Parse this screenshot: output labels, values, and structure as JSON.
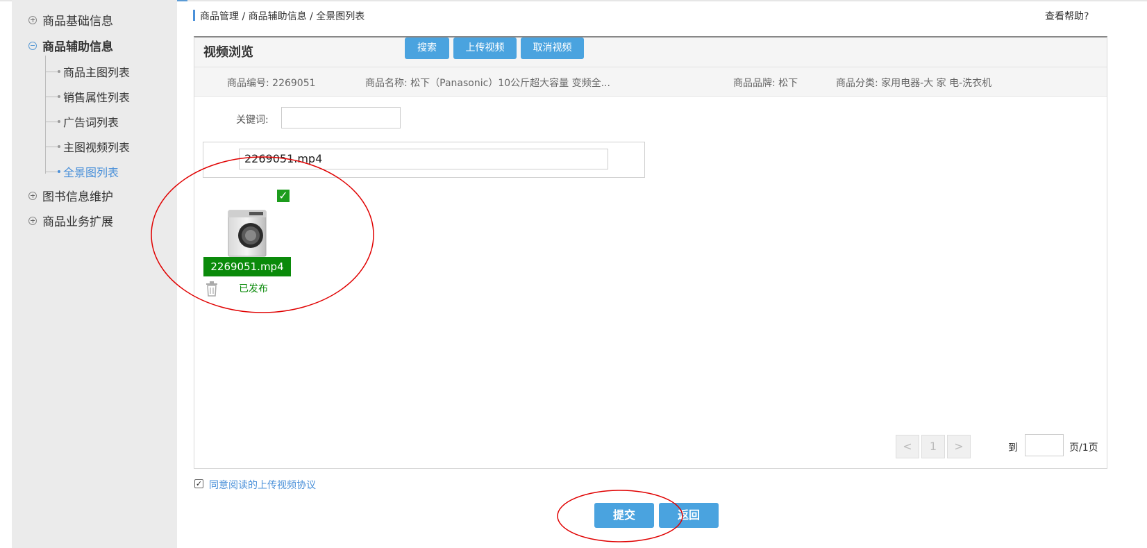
{
  "sidebar": {
    "groups": [
      {
        "label": "商品基础信息"
      },
      {
        "label": "商品辅助信息"
      },
      {
        "label": "图书信息维护"
      },
      {
        "label": "商品业务扩展"
      }
    ],
    "items": [
      {
        "label": "商品主图列表"
      },
      {
        "label": "销售属性列表"
      },
      {
        "label": "广告词列表"
      },
      {
        "label": "主图视频列表"
      },
      {
        "label": "全景图列表"
      }
    ]
  },
  "breadcrumb": "商品管理 / 商品辅助信息 / 全景图列表",
  "help_link": "查看帮助?",
  "panel": {
    "title": "视频浏览",
    "info": {
      "code": "商品编号:  2269051",
      "name": "商品名称:  松下（Panasonic）10公斤超大容量 变频全...",
      "brand": "商品品牌:  松下",
      "category": "商品分类:  家用电器-大 家 电-洗衣机"
    },
    "search": {
      "keyword_label": "关键词:",
      "keyword_value": "",
      "search_btn": "搜索",
      "upload_btn": "上传视频",
      "cancel_btn": "取消视频"
    },
    "file_name_value": "2269051.mp4",
    "video": {
      "checked": true,
      "badge": "2269051.mp4",
      "status": "已发布"
    },
    "pager": {
      "prev": "<",
      "current": "1",
      "next": ">",
      "goto_label": "到",
      "goto_value": "",
      "total": "页/1页"
    }
  },
  "agreement": {
    "checked": true,
    "label": "同意阅读的上传视频协议"
  },
  "actions": {
    "submit": "提交",
    "back": "返回"
  },
  "colors": {
    "accent": "#4aa3df",
    "success": "#0a8a0a",
    "annotation": "#e00000"
  }
}
